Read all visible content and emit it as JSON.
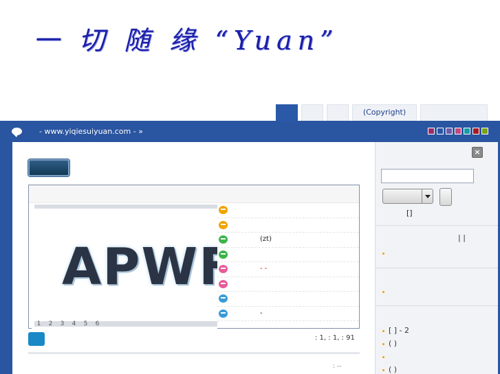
{
  "banner": {
    "logo_text": "一 切 随 缘 “Yuan”"
  },
  "tabs": [
    {
      "label": ""
    },
    {
      "label": ""
    },
    {
      "label": ""
    },
    {
      "label": "(Copyright)"
    },
    {
      "label": ""
    }
  ],
  "nav": {
    "path": "- www.yiqiesuiyuan.com - »",
    "theme_colors": [
      "#9b2b6c",
      "#2a55a0",
      "#6d5aa8",
      "#c2487e",
      "#199aa8",
      "#a51a22",
      "#7aa01a"
    ]
  },
  "slider": {
    "image_text": "APWF",
    "page_numbers": [
      "1",
      "2",
      "3",
      "4",
      "5",
      "6"
    ]
  },
  "topics": [
    {
      "icon_color": "#f2a300",
      "text": "",
      "dash": ""
    },
    {
      "icon_color": "#f2a300",
      "text": "",
      "dash": ""
    },
    {
      "icon_color": "#3bb54a",
      "text": "(zt)",
      "dash": ""
    },
    {
      "icon_color": "#3bb54a",
      "text": "",
      "dash": ""
    },
    {
      "icon_color": "#e75c9a",
      "text": "",
      "dash": "- -"
    },
    {
      "icon_color": "#e75c9a",
      "text": "",
      "dash": ""
    },
    {
      "icon_color": "#3a9ad8",
      "text": "",
      "dash": ""
    },
    {
      "icon_color": "#3a9ad8",
      "text": "-",
      "dash": ""
    }
  ],
  "main": {
    "stats": ": 1, : 1, : 91",
    "bottom_note": ":   --"
  },
  "sidebar": {
    "close_label": "×",
    "search": {
      "value": "",
      "placeholder": "",
      "advanced_label": "[]"
    },
    "section1_links": "| |",
    "section4_rows": [
      "[ ]   - 2",
      "( )",
      "",
      "( )"
    ]
  }
}
